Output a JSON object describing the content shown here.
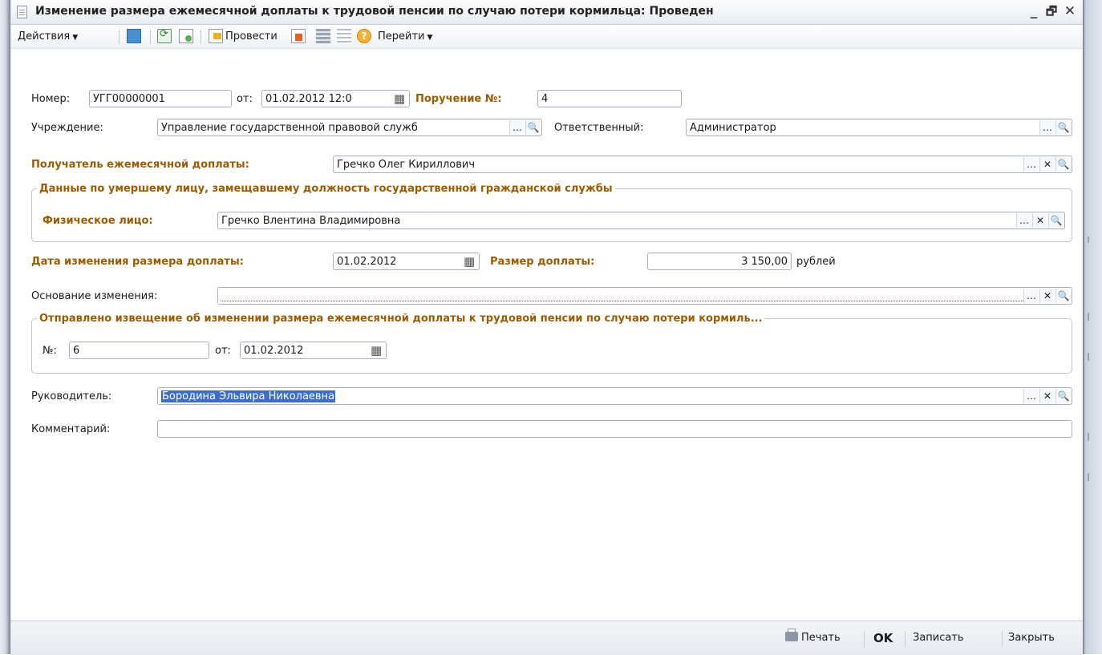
{
  "window": {
    "title": "Изменение размера ежемесячной доплаты к трудовой пенсии по случаю потери кормильца: Проведен",
    "minimize": "_",
    "restore": "🗗",
    "close": "✕"
  },
  "toolbar": {
    "actions": "Действия",
    "post": "Провести",
    "goto": "Перейти"
  },
  "form": {
    "number_label": "Номер:",
    "number_value": "УГГ00000001",
    "from_label": "от:",
    "date_value": "01.02.2012 12:0",
    "order_label": "Поручение №:",
    "order_value": "4",
    "institution_label": "Учреждение:",
    "institution_value": "Управление государственной правовой служб",
    "responsible_label": "Ответственный:",
    "responsible_value": "Администратор",
    "recipient_label": "Получатель ежемесячной доплаты:",
    "recipient_value": "Гречко Олег Кириллович",
    "deceased_group": {
      "legend": "Данные по умершему лицу, замещавшему должность государственной гражданской службы",
      "person_label": "Физическое лицо:",
      "person_value": "Гречко Влентина Владимировна"
    },
    "change_date_label": "Дата изменения размера доплаты:",
    "change_date_value": "01.02.2012",
    "amount_label": "Размер доплаты:",
    "amount_value": "3 150,00",
    "currency": "рублей",
    "reason_label": "Основание изменения:",
    "reason_value": "",
    "notice_group": {
      "legend": "Отправлено извещение об изменении размера ежемесячной доплаты к трудовой пенсии по случаю потери кормиль...",
      "no_label": "№:",
      "no_value": "6",
      "from_label": "от:",
      "date_value": "01.02.2012"
    },
    "head_label": "Руководитель:",
    "head_value": "Бородина Эльвира Николаевна",
    "comment_label": "Комментарий:",
    "comment_value": ""
  },
  "footer": {
    "print": "Печать",
    "ok": "OK",
    "save": "Записать",
    "close": "Закрыть"
  }
}
